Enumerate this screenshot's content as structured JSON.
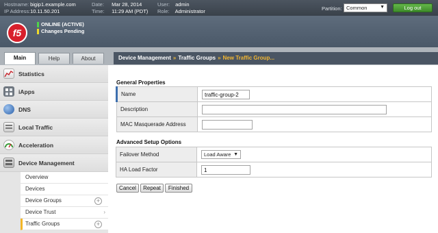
{
  "topbar": {
    "hostname_label": "Hostname:",
    "hostname": "bigip1.example.com",
    "ip_label": "IP Address:",
    "ip": "10.11.50.201",
    "date_label": "Date:",
    "date": "Mar 28, 2014",
    "time_label": "Time:",
    "time": "11:29 AM (PDT)",
    "user_label": "User:",
    "user": "admin",
    "role_label": "Role:",
    "role": "Administrator",
    "partition_label": "Partition:",
    "partition_value": "Common",
    "logout_label": "Log out"
  },
  "header": {
    "logo_text": "f5",
    "status_online": "ONLINE (ACTIVE)",
    "status_changes": "Changes Pending"
  },
  "tabs": [
    {
      "label": "Main"
    },
    {
      "label": "Help"
    },
    {
      "label": "About"
    }
  ],
  "breadcrumb": {
    "part1": "Device Management",
    "sep": "»",
    "part2": "Traffic Groups",
    "part3": "New Traffic Group..."
  },
  "sidebar": {
    "items": [
      {
        "label": "Statistics",
        "icon": "statistics-icon"
      },
      {
        "label": "iApps",
        "icon": "iapps-icon"
      },
      {
        "label": "DNS",
        "icon": "dns-icon"
      },
      {
        "label": "Local Traffic",
        "icon": "local-traffic-icon"
      },
      {
        "label": "Acceleration",
        "icon": "acceleration-icon"
      },
      {
        "label": "Device Management",
        "icon": "device-management-icon"
      }
    ],
    "subitems": [
      {
        "label": "Overview"
      },
      {
        "label": "Devices"
      },
      {
        "label": "Device Groups"
      },
      {
        "label": "Device Trust"
      },
      {
        "label": "Traffic Groups"
      }
    ]
  },
  "general": {
    "title": "General Properties",
    "name_label": "Name",
    "name_value": "traffic-group-2",
    "description_label": "Description",
    "description_value": "",
    "mac_label": "MAC Masquerade Address",
    "mac_value": ""
  },
  "advanced": {
    "title": "Advanced Setup Options",
    "failover_label": "Failover Method",
    "failover_value": "Load Aware",
    "ha_label": "HA Load Factor",
    "ha_value": "1"
  },
  "buttons": {
    "cancel": "Cancel",
    "repeat": "Repeat",
    "finished": "Finished"
  },
  "colors": {
    "accent": "#f3b627",
    "brand": "#d8202c",
    "online": "#4fd44a",
    "pending": "#f0dc2a",
    "logout": "#4fa137"
  }
}
